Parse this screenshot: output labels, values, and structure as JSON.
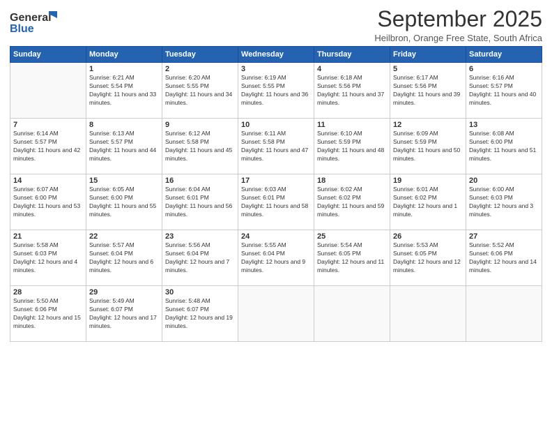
{
  "header": {
    "logo_general": "General",
    "logo_blue": "Blue",
    "month_title": "September 2025",
    "location": "Heilbron, Orange Free State, South Africa"
  },
  "weekdays": [
    "Sunday",
    "Monday",
    "Tuesday",
    "Wednesday",
    "Thursday",
    "Friday",
    "Saturday"
  ],
  "weeks": [
    [
      {
        "day": "",
        "empty": true
      },
      {
        "day": "1",
        "sunrise": "6:21 AM",
        "sunset": "5:54 PM",
        "daylight": "11 hours and 33 minutes."
      },
      {
        "day": "2",
        "sunrise": "6:20 AM",
        "sunset": "5:55 PM",
        "daylight": "11 hours and 34 minutes."
      },
      {
        "day": "3",
        "sunrise": "6:19 AM",
        "sunset": "5:55 PM",
        "daylight": "11 hours and 36 minutes."
      },
      {
        "day": "4",
        "sunrise": "6:18 AM",
        "sunset": "5:56 PM",
        "daylight": "11 hours and 37 minutes."
      },
      {
        "day": "5",
        "sunrise": "6:17 AM",
        "sunset": "5:56 PM",
        "daylight": "11 hours and 39 minutes."
      },
      {
        "day": "6",
        "sunrise": "6:16 AM",
        "sunset": "5:57 PM",
        "daylight": "11 hours and 40 minutes."
      }
    ],
    [
      {
        "day": "7",
        "sunrise": "6:14 AM",
        "sunset": "5:57 PM",
        "daylight": "11 hours and 42 minutes."
      },
      {
        "day": "8",
        "sunrise": "6:13 AM",
        "sunset": "5:57 PM",
        "daylight": "11 hours and 44 minutes."
      },
      {
        "day": "9",
        "sunrise": "6:12 AM",
        "sunset": "5:58 PM",
        "daylight": "11 hours and 45 minutes."
      },
      {
        "day": "10",
        "sunrise": "6:11 AM",
        "sunset": "5:58 PM",
        "daylight": "11 hours and 47 minutes."
      },
      {
        "day": "11",
        "sunrise": "6:10 AM",
        "sunset": "5:59 PM",
        "daylight": "11 hours and 48 minutes."
      },
      {
        "day": "12",
        "sunrise": "6:09 AM",
        "sunset": "5:59 PM",
        "daylight": "11 hours and 50 minutes."
      },
      {
        "day": "13",
        "sunrise": "6:08 AM",
        "sunset": "6:00 PM",
        "daylight": "11 hours and 51 minutes."
      }
    ],
    [
      {
        "day": "14",
        "sunrise": "6:07 AM",
        "sunset": "6:00 PM",
        "daylight": "11 hours and 53 minutes."
      },
      {
        "day": "15",
        "sunrise": "6:05 AM",
        "sunset": "6:00 PM",
        "daylight": "11 hours and 55 minutes."
      },
      {
        "day": "16",
        "sunrise": "6:04 AM",
        "sunset": "6:01 PM",
        "daylight": "11 hours and 56 minutes."
      },
      {
        "day": "17",
        "sunrise": "6:03 AM",
        "sunset": "6:01 PM",
        "daylight": "11 hours and 58 minutes."
      },
      {
        "day": "18",
        "sunrise": "6:02 AM",
        "sunset": "6:02 PM",
        "daylight": "11 hours and 59 minutes."
      },
      {
        "day": "19",
        "sunrise": "6:01 AM",
        "sunset": "6:02 PM",
        "daylight": "12 hours and 1 minute."
      },
      {
        "day": "20",
        "sunrise": "6:00 AM",
        "sunset": "6:03 PM",
        "daylight": "12 hours and 3 minutes."
      }
    ],
    [
      {
        "day": "21",
        "sunrise": "5:58 AM",
        "sunset": "6:03 PM",
        "daylight": "12 hours and 4 minutes."
      },
      {
        "day": "22",
        "sunrise": "5:57 AM",
        "sunset": "6:04 PM",
        "daylight": "12 hours and 6 minutes."
      },
      {
        "day": "23",
        "sunrise": "5:56 AM",
        "sunset": "6:04 PM",
        "daylight": "12 hours and 7 minutes."
      },
      {
        "day": "24",
        "sunrise": "5:55 AM",
        "sunset": "6:04 PM",
        "daylight": "12 hours and 9 minutes."
      },
      {
        "day": "25",
        "sunrise": "5:54 AM",
        "sunset": "6:05 PM",
        "daylight": "12 hours and 11 minutes."
      },
      {
        "day": "26",
        "sunrise": "5:53 AM",
        "sunset": "6:05 PM",
        "daylight": "12 hours and 12 minutes."
      },
      {
        "day": "27",
        "sunrise": "5:52 AM",
        "sunset": "6:06 PM",
        "daylight": "12 hours and 14 minutes."
      }
    ],
    [
      {
        "day": "28",
        "sunrise": "5:50 AM",
        "sunset": "6:06 PM",
        "daylight": "12 hours and 15 minutes."
      },
      {
        "day": "29",
        "sunrise": "5:49 AM",
        "sunset": "6:07 PM",
        "daylight": "12 hours and 17 minutes."
      },
      {
        "day": "30",
        "sunrise": "5:48 AM",
        "sunset": "6:07 PM",
        "daylight": "12 hours and 19 minutes."
      },
      {
        "day": "",
        "empty": true
      },
      {
        "day": "",
        "empty": true
      },
      {
        "day": "",
        "empty": true
      },
      {
        "day": "",
        "empty": true
      }
    ]
  ]
}
